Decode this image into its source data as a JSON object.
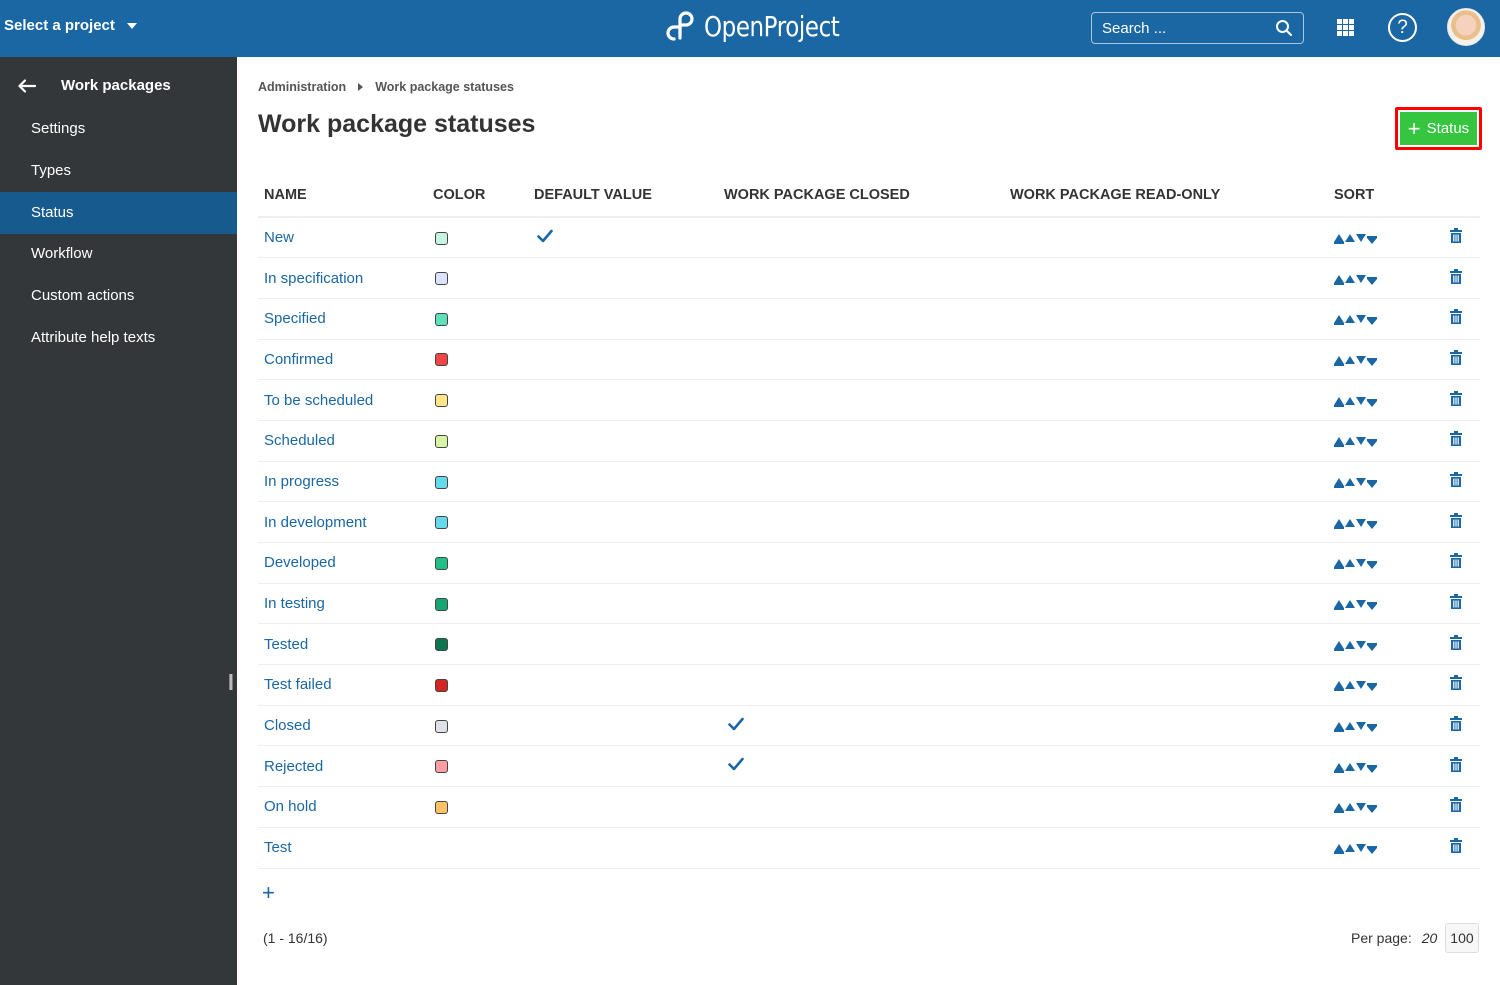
{
  "header": {
    "project_select": "Select a project",
    "logo_text": "OpenProject",
    "search_placeholder": "Search ...",
    "help_label": "?"
  },
  "sidebar": {
    "back_label": "Work packages",
    "items": [
      {
        "label": "Settings",
        "active": false
      },
      {
        "label": "Types",
        "active": false
      },
      {
        "label": "Status",
        "active": true
      },
      {
        "label": "Workflow",
        "active": false
      },
      {
        "label": "Custom actions",
        "active": false
      },
      {
        "label": "Attribute help texts",
        "active": false
      }
    ]
  },
  "breadcrumb": [
    "Administration",
    "Work package statuses"
  ],
  "page_title": "Work package statuses",
  "add_button_label": "Status",
  "table": {
    "columns": [
      "NAME",
      "COLOR",
      "DEFAULT VALUE",
      "WORK PACKAGE CLOSED",
      "WORK PACKAGE READ-ONLY",
      "SORT"
    ],
    "rows": [
      {
        "name": "New",
        "color": "#c7f4e0",
        "default": true,
        "closed": false,
        "readonly": false
      },
      {
        "name": "In specification",
        "color": "#dbe4ff",
        "default": false,
        "closed": false,
        "readonly": false
      },
      {
        "name": "Specified",
        "color": "#5ee0b8",
        "default": false,
        "closed": false,
        "readonly": false
      },
      {
        "name": "Confirmed",
        "color": "#f24545",
        "default": false,
        "closed": false,
        "readonly": false
      },
      {
        "name": "To be scheduled",
        "color": "#ffe68a",
        "default": false,
        "closed": false,
        "readonly": false
      },
      {
        "name": "Scheduled",
        "color": "#d8f5a3",
        "default": false,
        "closed": false,
        "readonly": false
      },
      {
        "name": "In progress",
        "color": "#66d9ea",
        "default": false,
        "closed": false,
        "readonly": false
      },
      {
        "name": "In development",
        "color": "#66d9ea",
        "default": false,
        "closed": false,
        "readonly": false
      },
      {
        "name": "Developed",
        "color": "#1fbf86",
        "default": false,
        "closed": false,
        "readonly": false
      },
      {
        "name": "In testing",
        "color": "#17a673",
        "default": false,
        "closed": false,
        "readonly": false
      },
      {
        "name": "Tested",
        "color": "#0d7550",
        "default": false,
        "closed": false,
        "readonly": false
      },
      {
        "name": "Test failed",
        "color": "#d42424",
        "default": false,
        "closed": false,
        "readonly": false
      },
      {
        "name": "Closed",
        "color": "#dee2e6",
        "default": false,
        "closed": true,
        "readonly": false
      },
      {
        "name": "Rejected",
        "color": "#ff9ea0",
        "default": false,
        "closed": true,
        "readonly": false
      },
      {
        "name": "On hold",
        "color": "#ffc266",
        "default": false,
        "closed": false,
        "readonly": false
      },
      {
        "name": "Test",
        "color": null,
        "default": false,
        "closed": false,
        "readonly": false
      }
    ]
  },
  "pagination": {
    "info": "(1 - 16/16)",
    "per_page_label": "Per page:",
    "options": [
      "20",
      "100"
    ],
    "selected": "100"
  },
  "colors": {
    "header_bg": "#1a67a3",
    "sidebar_bg": "#333739",
    "sidebar_active": "#175a8e",
    "link": "#1a67a3",
    "add_button": "#35c53f",
    "highlight_border": "#ff0000"
  }
}
